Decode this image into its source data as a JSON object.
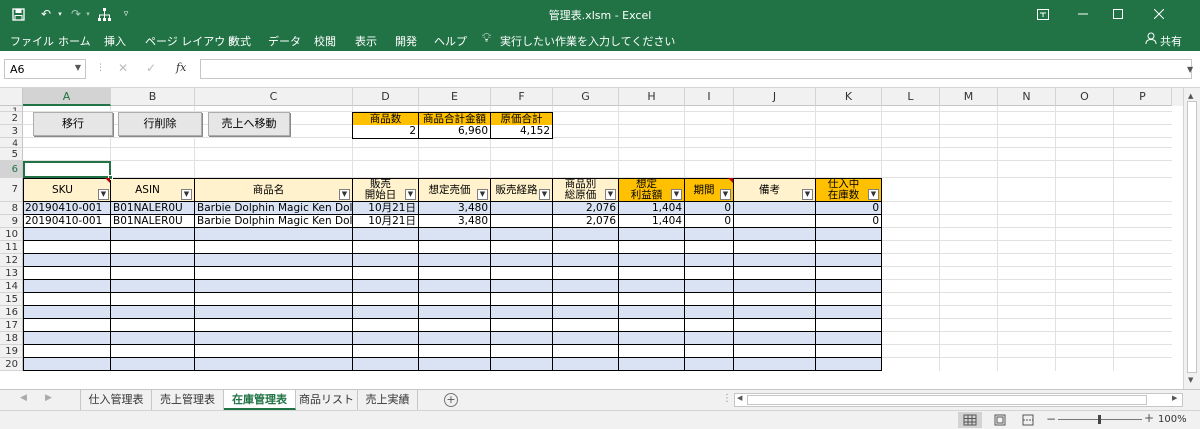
{
  "titlebar": {
    "title": "管理表.xlsm  -  Excel"
  },
  "ribbon_tabs": [
    "ファイル",
    "ホーム",
    "挿入",
    "ページ レイアウト",
    "数式",
    "データ",
    "校閲",
    "表示",
    "開発",
    "ヘルプ"
  ],
  "tell_me": "実行したい作業を入力してください",
  "share_label": "共有",
  "namebox": "A6",
  "fx_label": "fx",
  "columns": [
    "A",
    "B",
    "C",
    "D",
    "E",
    "F",
    "G",
    "H",
    "I",
    "J",
    "K",
    "L",
    "M",
    "N",
    "O",
    "P"
  ],
  "rows": [
    "1",
    "2",
    "3",
    "4",
    "5",
    "6",
    "7",
    "8",
    "9",
    "10",
    "11",
    "12",
    "13",
    "14",
    "15",
    "16",
    "17",
    "18",
    "19",
    "20"
  ],
  "buttons": {
    "move": "移行",
    "delete_row": "行削除",
    "move_to_sales": "売上へ移動"
  },
  "summary": {
    "headers": [
      "商品数",
      "商品合計金額",
      "原価合計"
    ],
    "values": [
      "2",
      "6,960",
      "4,152"
    ]
  },
  "table_headers": [
    "SKU",
    "ASIN",
    "商品名",
    "販売\n開始日",
    "想定売価",
    "販売経路",
    "商品別\n総原価",
    "想定\n利益額",
    "期間",
    "備考",
    "仕入中\n在庫数"
  ],
  "table_rows": [
    [
      "20190410-001",
      "B01NALER0U",
      "Barbie Dolphin Magic Ken Doll",
      "10月21日",
      "3,480",
      "",
      "2,076",
      "1,404",
      "0",
      "",
      "0"
    ],
    [
      "20190410-001",
      "B01NALER0U",
      "Barbie Dolphin Magic Ken Doll",
      "10月21日",
      "3,480",
      "",
      "2,076",
      "1,404",
      "0",
      "",
      "0"
    ]
  ],
  "sheet_tabs": [
    "仕入管理表",
    "売上管理表",
    "在庫管理表",
    "商品リスト",
    "売上実績"
  ],
  "active_sheet": "在庫管理表",
  "zoom": "100%",
  "colors": {
    "excel_green": "#217346",
    "header_orange": "#ffc000",
    "header_cream": "#fff2cc",
    "band_blue": "#dae3f3"
  }
}
